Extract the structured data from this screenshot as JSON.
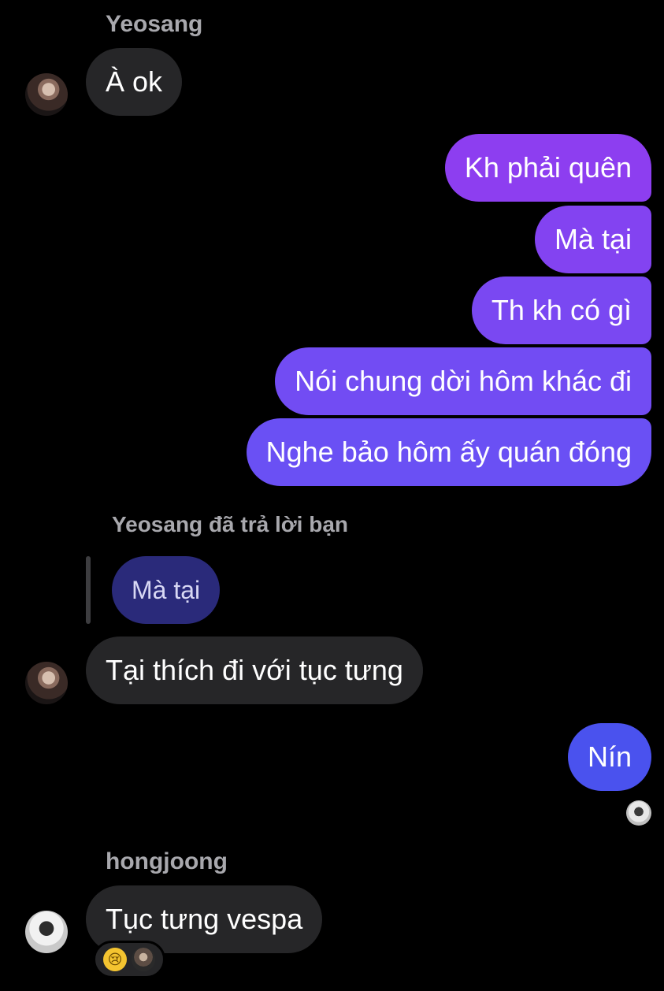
{
  "colors": {
    "background": "#000000",
    "incoming_bubble": "#262628",
    "outgoing_gradient": [
      "#6b4ef4",
      "#8a3ff0"
    ],
    "outgoing_blue": "#4a52ee",
    "reply_quote": "#2a2a7a",
    "sender_text": "#a8a8ad"
  },
  "thread": {
    "group1": {
      "sender": "Yeosang",
      "avatar_icon": "yeosang-avatar",
      "message": "À ok"
    },
    "outgoing": [
      "Kh phải quên",
      "Mà tại",
      "Th kh có gì",
      "Nói chung dời hôm khác đi",
      "Nghe bảo hôm ấy quán đóng"
    ],
    "reply": {
      "caption": "Yeosang đã trả lời bạn",
      "quoted": "Mà tại",
      "message": "Tại thích đi với tục tưng"
    },
    "outgoing2": {
      "message": "Nín",
      "seen_icon": "seen-avatar"
    },
    "group2": {
      "sender": "hongjoong",
      "avatar_icon": "hongjoong-avatar",
      "message": "Tục tưng vespa",
      "reactions": [
        "crying-emoji",
        "reactor-avatar"
      ]
    }
  }
}
